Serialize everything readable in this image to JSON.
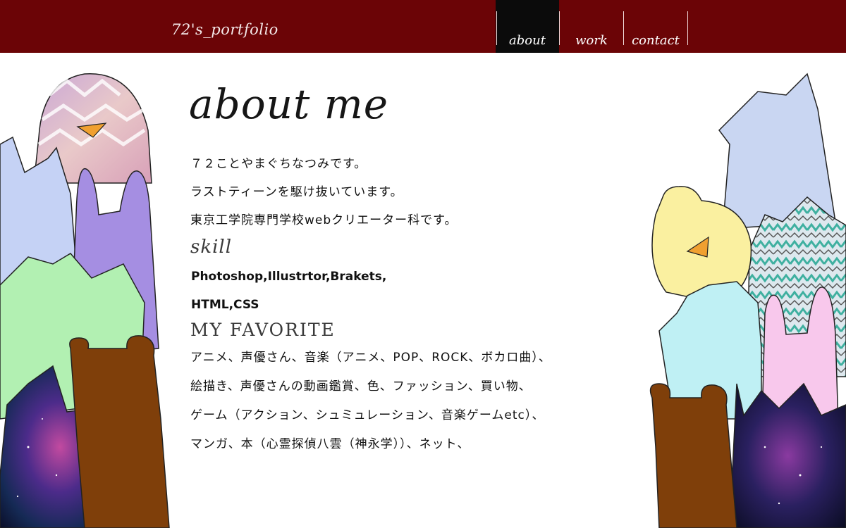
{
  "header": {
    "logo": "72's_portfolio",
    "nav": [
      {
        "label": "about",
        "active": true
      },
      {
        "label": "work",
        "active": false
      },
      {
        "label": "contact",
        "active": false
      }
    ]
  },
  "colors": {
    "header_bg": "#6b0406",
    "nav_active_bg": "#0b0b0b",
    "page_bg": "#ffffff"
  },
  "main": {
    "title": "about me",
    "intro": [
      "７２ことやまぐちなつみです。",
      "ラストティーンを駆け抜いています。",
      "東京工学院専門学校webクリエーター科です。"
    ],
    "skill": {
      "heading": "skill",
      "lines": [
        "Photoshop,Illustrtor,Brakets,",
        "HTML,CSS"
      ]
    },
    "favorite": {
      "heading": "MY FAVORITE",
      "lines": [
        "アニメ、声優さん、音楽（アニメ、POP、ROCK、ボカロ曲）、",
        "絵描き、声優さんの動画鑑賞、色、ファッション、買い物、",
        "ゲーム（アクション、シュミュレーション、音楽ゲームetc）、",
        "マンガ、本（心霊探偵八雲（神永学））、ネット、"
      ]
    }
  },
  "illustrations": {
    "left": [
      "penguin-character",
      "blue-cat-character",
      "purple-rabbit-character",
      "green-cat-character",
      "galaxy-cat-character",
      "brown-bear-character"
    ],
    "right": [
      "blue-cat-character",
      "yellow-chick-character",
      "aztec-cat-character",
      "cyan-cat-character",
      "pink-rabbit-character",
      "galaxy-cat-character",
      "brown-bear-character"
    ]
  }
}
